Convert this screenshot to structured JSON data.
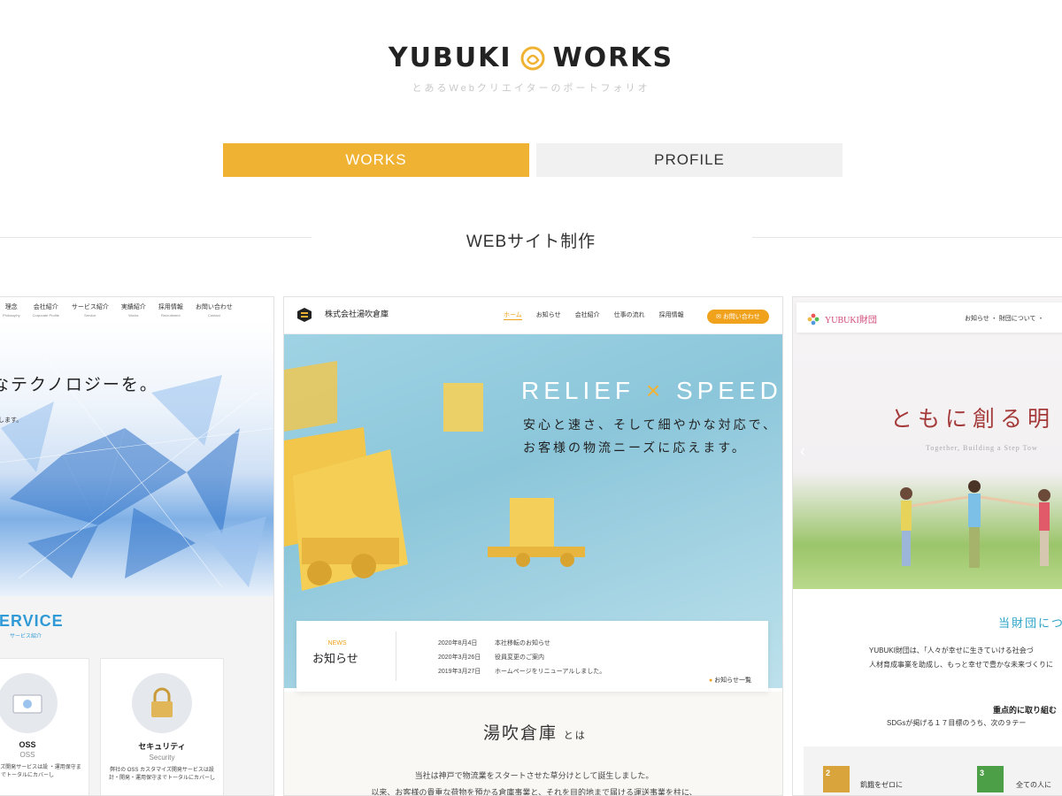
{
  "brand": {
    "left": "YUBUKI",
    "right": "WORKS",
    "tagline": "とあるWebクリエイターのポートフォリオ",
    "accent": "#f0b232"
  },
  "tabs": [
    {
      "label": "WORKS",
      "active": true
    },
    {
      "label": "PROFILE",
      "active": false
    }
  ],
  "section": {
    "title": "WEBサイト制作"
  },
  "card1": {
    "nav": [
      {
        "label": "理念",
        "sub": "Philosophy"
      },
      {
        "label": "会社紹介",
        "sub": "Corporate Profile"
      },
      {
        "label": "サービス紹介",
        "sub": "Service"
      },
      {
        "label": "実績紹介",
        "sub": "Works"
      },
      {
        "label": "採用情報",
        "sub": "Recruitment"
      },
      {
        "label": "お問い合わせ",
        "sub": "Contact"
      }
    ],
    "hero_text": "なテクノロジーを。",
    "hero_sub": "に​します。",
    "service_title": "ERVICE",
    "service_sub": "サービス紹介",
    "services": [
      {
        "title": "OSS",
        "sub": "OSS",
        "desc": "カスタマイズ開発サービスは設 ・運用保守までトータルにカバーし"
      },
      {
        "title": "セキュリティ",
        "sub": "Security",
        "desc": "弊社の OSS カスタマイズ開発サービスは設 計・開発・運用保守までトータルにカバーし"
      }
    ]
  },
  "card2": {
    "company": "株式会社湯吹倉庫",
    "nav": [
      {
        "label": "ホーム",
        "active": true
      },
      {
        "label": "お知らせ",
        "active": false
      },
      {
        "label": "会社紹介",
        "active": false
      },
      {
        "label": "仕事の流れ",
        "active": false
      },
      {
        "label": "採用情報",
        "active": false
      }
    ],
    "contact": "お問い合わせ",
    "hero_left": "RELIEF",
    "hero_x": "×",
    "hero_right": "SPEED",
    "copy1": "安心と速さ、そして細やかな対応で、",
    "copy2": "お客様の物流ニーズに応えます。",
    "news_label": "NEWS",
    "news_title": "お知らせ",
    "news": [
      {
        "date": "2020年8月4日",
        "text": "本社移転のお知らせ"
      },
      {
        "date": "2020年3月26日",
        "text": "役員変更のご案内"
      },
      {
        "date": "2019年3月27日",
        "text": "ホームページをリニューアルしました。"
      }
    ],
    "news_more": "お知らせ一覧",
    "about_title": "湯吹倉庫",
    "about_suffix": "とは",
    "about_p1": "当社は神戸で物流業をスタートさせた草分けとして誕生しました。",
    "about_p2": "以来、お客様の貴重な荷物を預かる倉庫事業と、それを目的地まで届ける運送事業を柱に、"
  },
  "card3": {
    "brand": "YUBUKI財団",
    "nav": "お知らせ ・ 財団について ・",
    "catch": "ともに創る明",
    "catch_sub": "Together, Building a Step Tow",
    "about_title": "当財団につ",
    "about_p1": "YUBUKI財団は、「人々が幸せに生きていける社会づ",
    "about_p2": "人材育成事業を助成し、もっと幸せで豊かな未来づくりに",
    "focus_title": "重点的に取り組む",
    "focus_p": "SDGsが掲げる１７目標のうち、次の９テー",
    "sdgs": [
      {
        "num": "2",
        "label": "飢餓をゼロに",
        "color": "#d8a43b"
      },
      {
        "num": "3",
        "label": "全ての人に",
        "color": "#4c9f46"
      }
    ]
  }
}
